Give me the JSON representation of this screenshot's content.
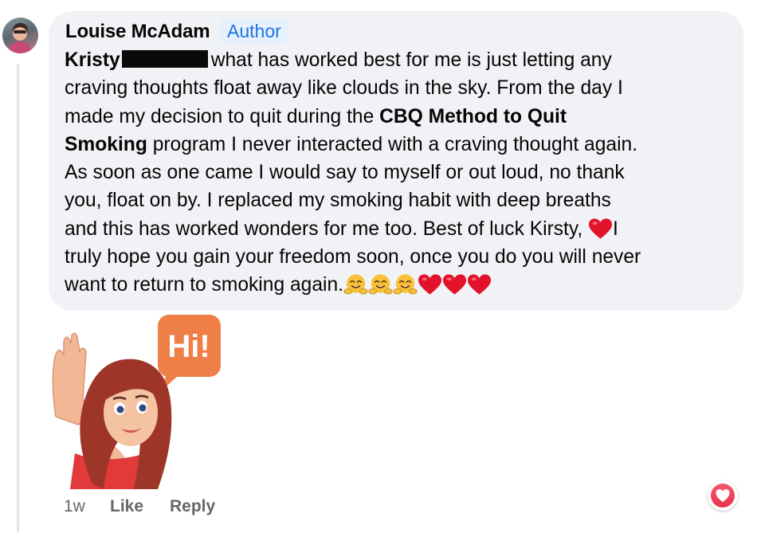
{
  "comment": {
    "author": "Louise McAdam",
    "badge": "Author",
    "mention_first_name": "Kristy",
    "lines": {
      "l1": "what has worked best for me is just letting any",
      "l2": "craving thoughts float away like clouds in the sky. From the day I",
      "l3a": "made my decision to quit during the ",
      "l3b": "CBQ Method to Quit",
      "l4a": "Smoking",
      "l4b": " program I never interacted with a craving thought again.",
      "l5": "As soon as one came I would say to myself or out loud, no thank",
      "l6": "you, float on by. I replaced my smoking habit with deep breaths",
      "l7": "and this has worked wonders for me too. Best of luck Kirsty, ",
      "l7b": "I",
      "l8": "truly hope you gain your freedom soon, once you do you will never",
      "l9": "want to return to smoking again."
    },
    "emojis": [
      "hugging-face",
      "hugging-face",
      "hugging-face",
      "red-heart",
      "red-heart",
      "red-heart"
    ]
  },
  "sticker": {
    "text": "Hi!",
    "bubble_color": "#f07f47"
  },
  "actions": {
    "time": "1w",
    "like": "Like",
    "reply": "Reply"
  },
  "reaction": {
    "type": "love",
    "color": "#f0405a"
  },
  "colors": {
    "bubble": "#f0f2f5",
    "badge_text": "#1b74e4",
    "meta": "#65676b"
  }
}
